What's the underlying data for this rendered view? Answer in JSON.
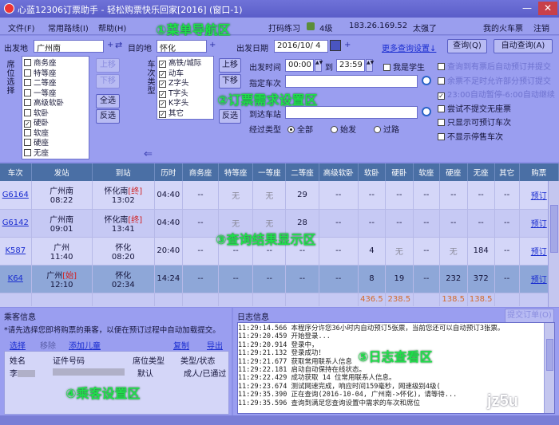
{
  "titlebar": {
    "title": "心蓝12306订票助手 - 轻松购票快乐回家[2016] (窗口-1)",
    "min_glyph": "—",
    "close_glyph": "✕"
  },
  "menu": {
    "file": "文件(F)",
    "routes": "常用路线(I)",
    "help": "帮助(H)",
    "captcha": "打码练习",
    "level": "4级",
    "ip": "183.26.169.52",
    "user": "太强了",
    "my_tickets": "我的火车票",
    "logout": "注销"
  },
  "overlays": {
    "menu_nav": "①菜单导航区",
    "ticket_req": "②订票需求设置区",
    "results": "③查询结果显示区",
    "passenger": "④乘客设置区",
    "log": "⑤日志查看区"
  },
  "search": {
    "from_label": "出发地",
    "from_value": "广州南",
    "to_label": "目的地",
    "to_value": "怀化",
    "date_label": "出发日期",
    "date_value": "2016/10/ 4",
    "more_settings": "更多查询设置↓",
    "query_btn": "查询(Q)",
    "auto_query_btn": "自动查询(A)"
  },
  "seat_types": {
    "vertical_label": "席位选择",
    "items": [
      "商务座",
      "特等座",
      "二等座",
      "一等座",
      "高级软卧",
      "软卧",
      "硬卧",
      "软座",
      "硬座",
      "无座"
    ],
    "checked": [
      false,
      false,
      false,
      false,
      false,
      false,
      true,
      false,
      false,
      false
    ],
    "btn_up": "上移",
    "btn_down": "下移",
    "btn_all": "全选",
    "btn_invert": "反选"
  },
  "train_types": {
    "vertical_label": "车次类型",
    "items": [
      "高铁/城际",
      "动车",
      "Z字头",
      "T字头",
      "K字头",
      "其它"
    ],
    "checked": [
      true,
      true,
      true,
      true,
      true,
      true
    ],
    "arrow": "⇐"
  },
  "options": {
    "btn_up": "上移",
    "btn_down": "下移",
    "btn_invert": "反选",
    "depart_time_label": "出发时间",
    "time_from": "00:00",
    "time_to_label": "到",
    "time_to": "23:59",
    "student_label": "我是学生",
    "specify_train_label": "指定车次",
    "arrive_station_label": "到达车站",
    "pass_type_label": "经过类型",
    "pass_all": "全部",
    "pass_start": "始发",
    "pass_through": "过路",
    "right_opts": [
      {
        "text": "查询到有票后自动预订并提交",
        "checked": false,
        "disabled": true
      },
      {
        "text": "余票不足时允许部分预订提交",
        "checked": false,
        "disabled": true
      },
      {
        "text": "23:00自动暂停-6:00自动继续",
        "checked": true,
        "disabled": true
      },
      {
        "text": "尝试不提交无座票",
        "checked": false,
        "disabled": false
      },
      {
        "text": "只显示可预订车次",
        "checked": false,
        "disabled": false
      },
      {
        "text": "不显示停售车次",
        "checked": false,
        "disabled": false
      }
    ]
  },
  "results": {
    "headers": [
      "车次",
      "发站",
      "到站",
      "历时",
      "商务座",
      "特等座",
      "一等座",
      "二等座",
      "高级软卧",
      "软卧",
      "硬卧",
      "软座",
      "硬座",
      "无座",
      "其它",
      "购票"
    ],
    "rows": [
      {
        "train": "G6164",
        "from_station": "广州南",
        "from_time": "08:22",
        "to_station": "怀化南",
        "to_tag": "[终]",
        "to_time": "13:02",
        "duration": "04:40",
        "swz": "--",
        "tdz": "无",
        "ydz": "无",
        "edz": "29",
        "gjrw": "--",
        "rw": "--",
        "yw": "--",
        "rz": "--",
        "yz": "--",
        "wz": "--",
        "qt": "--",
        "buy": "预订"
      },
      {
        "train": "G6142",
        "from_station": "广州南",
        "from_time": "09:01",
        "to_station": "怀化南",
        "to_tag": "[终]",
        "to_time": "13:41",
        "duration": "04:40",
        "swz": "--",
        "tdz": "无",
        "ydz": "无",
        "edz": "28",
        "gjrw": "--",
        "rw": "--",
        "yw": "--",
        "rz": "--",
        "yz": "--",
        "wz": "--",
        "qt": "--",
        "buy": "预订"
      },
      {
        "train": "K587",
        "from_station": "广州",
        "from_time": "11:40",
        "to_station": "怀化",
        "to_tag": "",
        "to_time": "08:20",
        "duration": "20:40",
        "swz": "--",
        "tdz": "--",
        "ydz": "--",
        "edz": "--",
        "gjrw": "--",
        "rw": "4",
        "yw": "无",
        "rz": "--",
        "yz": "无",
        "wz": "184",
        "qt": "--",
        "buy": "预订"
      },
      {
        "train": "K64",
        "from_station": "广州",
        "from_tag": "[始]",
        "from_time": "12:10",
        "to_station": "怀化",
        "to_tag": "",
        "to_time": "02:34",
        "duration": "14:24",
        "swz": "--",
        "tdz": "--",
        "ydz": "--",
        "edz": "--",
        "gjrw": "--",
        "rw": "8",
        "yw": "19",
        "rz": "--",
        "yz": "232",
        "wz": "372",
        "qt": "--",
        "buy": "预订"
      }
    ],
    "summary": {
      "rw": "436.5",
      "yw": "238.5",
      "yz": "138.5",
      "wz": "138.5"
    }
  },
  "passenger": {
    "title": "乘客信息",
    "hint": "*请先选择您即将购票的乘客，以便在预订过程中自动加载提交。",
    "select": "选择",
    "remove": "移除",
    "add_child": "添加儿童",
    "copy": "复制",
    "export": "导出",
    "col_name": "姓名",
    "col_id": "证件号码",
    "col_seat": "席位类型",
    "col_type": "类型/状态",
    "row_name": "李",
    "row_seat": "默认",
    "row_type": "成人/已通过"
  },
  "log": {
    "title": "日志信息",
    "submit_btn": "提交订单(O)",
    "lines": [
      "11:29:14.566 本程序分许您36小时内自动预订5张票，当前您还可以自动预订3张票。",
      "11:29:20.459 开始登录...",
      "11:29:20.914 登录中，",
      "11:29:21.132 登录成功！",
      "11:29:21.677 获取常用联系人信息",
      "11:29:22.181 启动自动保持在线状态。",
      "11:29:22.429 成功获取 14 位常用联系人信息。",
      "11:29:23.674 测试网速完成，响应时间159毫秒，网速级别4级(",
      "11:29:35.390 正在查询(2016-10-04, 广州南->怀化)，请等待...",
      "11:29:35.596 查询到满足您查询设置中需求的车次和席位"
    ]
  },
  "watermark": "jz5u"
}
